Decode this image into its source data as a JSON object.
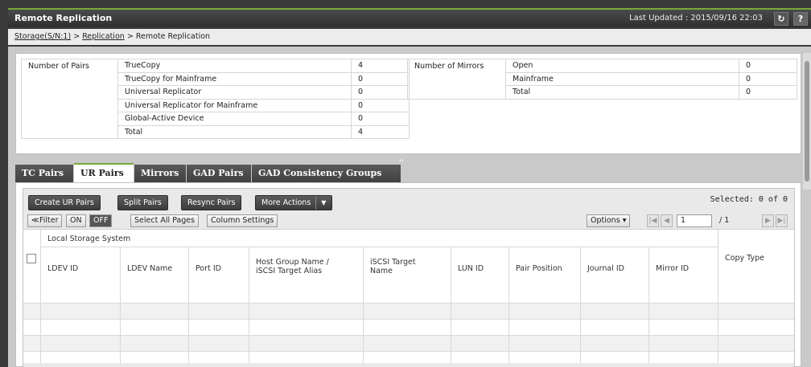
{
  "window": {
    "title": "Remote Replication",
    "last_updated": "Last Updated : 2015/09/16 22:03",
    "refresh_icon": "refresh-icon",
    "help_label": "?"
  },
  "breadcrumb": {
    "storage": "Storage(S/N:1)",
    "sep1": ">",
    "replication": "Replication",
    "sep2": ">",
    "current": "Remote Replication"
  },
  "summary": {
    "pairs_header": "Number of Pairs",
    "pairs": [
      {
        "label": "TrueCopy",
        "value": "4"
      },
      {
        "label": "TrueCopy for Mainframe",
        "value": "0"
      },
      {
        "label": "Universal Replicator",
        "value": "0"
      },
      {
        "label": "Universal Replicator for Mainframe",
        "value": "0"
      },
      {
        "label": "Global-Active Device",
        "value": "0"
      },
      {
        "label": "Total",
        "value": "4"
      }
    ],
    "mirrors_header": "Number of Mirrors",
    "mirrors": [
      {
        "label": "Open",
        "value": "0"
      },
      {
        "label": "Mainframe",
        "value": "0"
      },
      {
        "label": "Total",
        "value": "0"
      }
    ]
  },
  "tabs": [
    {
      "label": "TC Pairs"
    },
    {
      "label": "UR Pairs"
    },
    {
      "label": "Mirrors"
    },
    {
      "label": "GAD Pairs"
    },
    {
      "label": "GAD Consistency Groups"
    }
  ],
  "active_tab": "UR Pairs",
  "toolbar": {
    "create": "Create UR Pairs",
    "split": "Split Pairs",
    "resync": "Resync Pairs",
    "more": "More Actions",
    "selected": "Selected:  0   of  0"
  },
  "filterbar": {
    "filter": "Filter",
    "on": "ON",
    "off": "OFF",
    "select_all": "Select All Pages",
    "column_settings": "Column Settings",
    "options": "Options",
    "page": "1",
    "page_of": "/ 1"
  },
  "table": {
    "group_header": "Local Storage System",
    "columns": [
      "LDEV ID",
      "LDEV Name",
      "Port ID",
      "Host Group Name / iSCSI Target Alias",
      "iSCSI Target Name",
      "LUN ID",
      "Pair Position",
      "Journal ID",
      "Mirror ID",
      "Copy Type"
    ],
    "col_host_group_1": "Host Group Name /",
    "col_host_group_2": "iSCSI Target Alias",
    "col_iscsi_1": "iSCSI Target",
    "col_iscsi_2": "Name"
  },
  "colors": {
    "accent": "#79a83a",
    "titlebar": "#3a3a3a",
    "button": "#4a4a4a"
  }
}
